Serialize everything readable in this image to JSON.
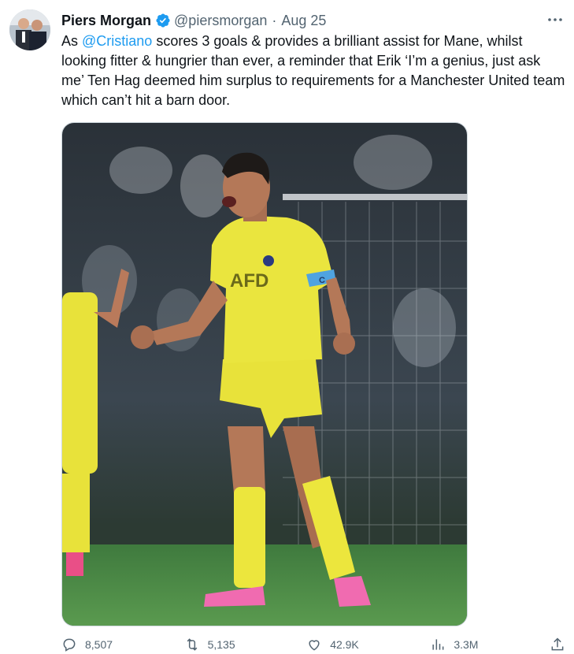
{
  "tweet": {
    "author_name": "Piers Morgan",
    "author_handle": "@piersmorgan",
    "separator": "·",
    "time": "Aug 25",
    "text_prefix": "As ",
    "mention": "@Cristiano",
    "text_body": " scores 3 goals & provides a brilliant assist for Mane, whilst looking fitter & hungrier than ever, a reminder that Erik ‘I’m a genius, just ask me’ Ten Hag deemed him surplus to requirements for a Manchester United team which can’t hit a barn door.",
    "accent_color": "#1d9bf0"
  },
  "media": {
    "jersey_text": "AFD",
    "armband_text": "C"
  },
  "actions": {
    "replies": "8,507",
    "retweets": "5,135",
    "likes": "42.9K",
    "views": "3.3M"
  },
  "icons": [
    "verified-badge-icon",
    "more-options-icon",
    "reply-icon",
    "retweet-icon",
    "like-icon",
    "views-icon",
    "share-icon"
  ]
}
